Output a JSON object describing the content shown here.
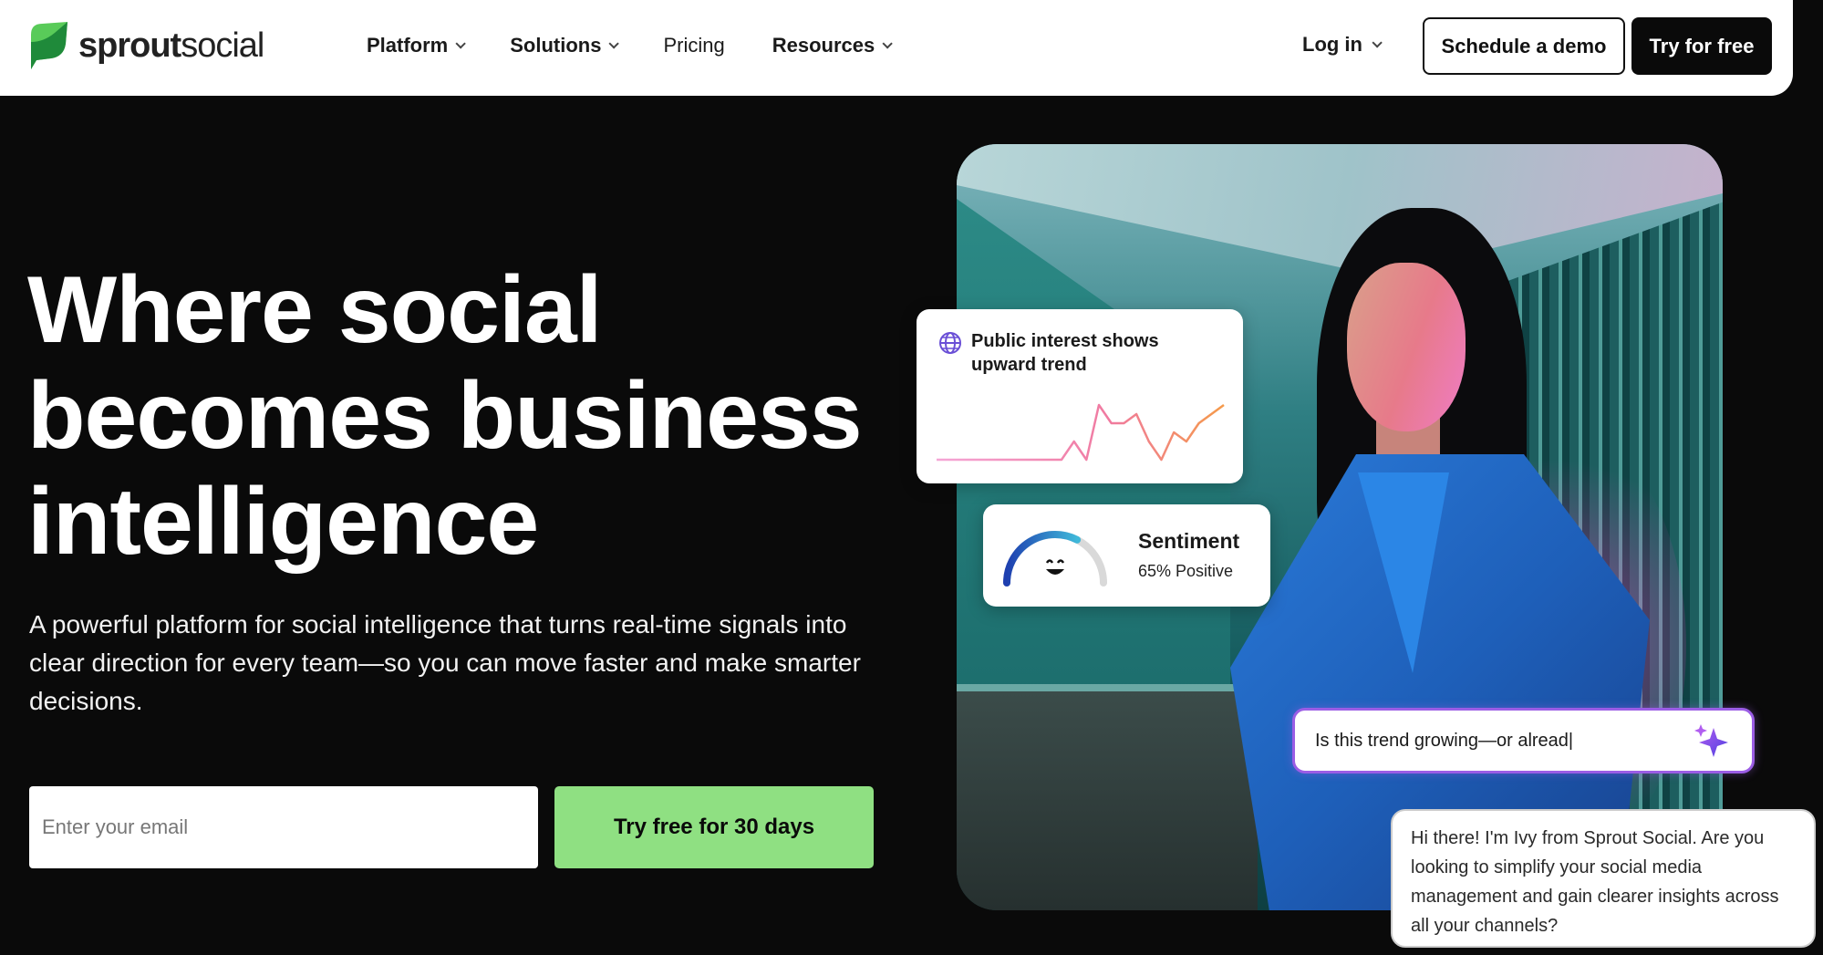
{
  "brand": {
    "name_bold": "sprout",
    "name_light": "social",
    "accent": "#59cb59"
  },
  "nav": {
    "items": [
      {
        "label": "Platform",
        "dropdown": true
      },
      {
        "label": "Solutions",
        "dropdown": true
      },
      {
        "label": "Pricing",
        "dropdown": false
      },
      {
        "label": "Resources",
        "dropdown": true
      }
    ],
    "login_label": "Log in",
    "demo_label": "Schedule a demo",
    "try_label": "Try for free"
  },
  "hero": {
    "headline": "Where social becomes business intelligence",
    "subtext": "A powerful platform for social intelligence that turns real-time signals into clear direction for every team—so you can move faster and make smarter decisions.",
    "email_placeholder": "Enter your email",
    "cta_label": "Try free for 30 days",
    "cta_color": "#8fe082"
  },
  "cards": {
    "trend": {
      "title": "Public interest shows upward trend",
      "icon": "globe-icon",
      "chart_data": {
        "type": "line",
        "values": [
          0,
          0,
          0,
          0,
          0,
          0,
          0,
          0,
          0,
          0,
          0,
          1,
          0,
          3,
          2,
          2,
          2.5,
          1,
          0,
          1.5,
          1,
          2,
          2.5,
          3
        ]
      }
    },
    "sentiment": {
      "title": "Sentiment",
      "value": "65% Positive",
      "fraction": 0.65
    },
    "prompt": {
      "text": "Is this trend growing—or alread|",
      "accent": "#9b5de5"
    },
    "chat": {
      "text": "Hi there! I'm Ivy from Sprout Social. Are you looking to simplify your social media management and gain clearer insights across all your channels?"
    }
  }
}
